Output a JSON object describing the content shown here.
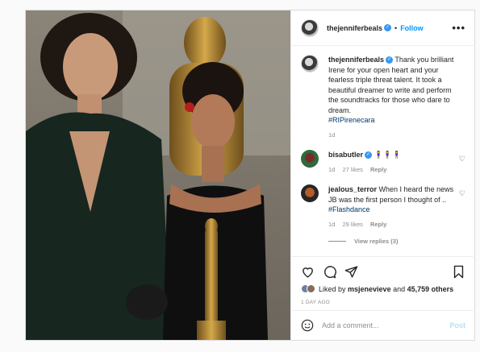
{
  "post": {
    "owner": "thejenniferbeals",
    "follow_label": "Follow",
    "separator": "•",
    "more_label": "•••"
  },
  "caption": {
    "user": "thejenniferbeals",
    "text": " Thank you brilliant Irene for your open heart and your fearless triple threat talent. It took a beautiful dreamer to write and perform the soundtracks for those who dare to dream.",
    "hashtag": "#RIPirenecara",
    "time": "1d"
  },
  "comments": [
    {
      "user": "bisabutler",
      "text": " ",
      "emojis": "🧍‍♀️🧍‍♀️🧍‍♀️",
      "time": "1d",
      "likes": "27 likes",
      "reply": "Reply"
    },
    {
      "user": "jealous_terror",
      "text": " When I heard the news JB was the first person I thought of .. ",
      "hashtag": "#Flashdance",
      "time": "1d",
      "likes": "29 likes",
      "reply": "Reply",
      "view_replies": "View replies (3)"
    }
  ],
  "actions": {
    "liked_by_prefix": "Liked by ",
    "liked_by_user": "msjenevieve",
    "and": " and ",
    "others": "45,759 others",
    "timestamp": "1 DAY AGO"
  },
  "add_comment": {
    "placeholder": "Add a comment...",
    "post_label": "Post"
  },
  "colors": {
    "link": "#0095f6",
    "verified": "#3897f0",
    "hashtag": "#00376b"
  }
}
